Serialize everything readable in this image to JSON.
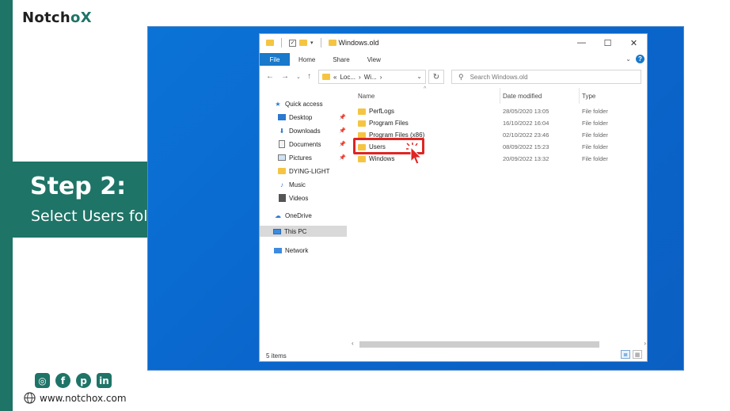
{
  "brand": {
    "name_main": "Notch",
    "name_o": "o",
    "name_x": "X"
  },
  "step": {
    "title": "Step 2:",
    "subtitle": "Select Users folder"
  },
  "social": {
    "instagram": "◎",
    "facebook": "f",
    "pinterest": "p",
    "linkedin": "in"
  },
  "website": "www.notchox.com",
  "explorer": {
    "window_title": "Windows.old",
    "tabs": [
      "File",
      "Home",
      "Share",
      "View"
    ],
    "address": {
      "prefix": "«",
      "part1": "Loc...",
      "part2": "Wi...",
      "sep": "›"
    },
    "search_placeholder": "Search Windows.old",
    "columns": {
      "name": "Name",
      "date": "Date modified",
      "type": "Type"
    },
    "nav": {
      "quick_access": "Quick access",
      "desktop": "Desktop",
      "downloads": "Downloads",
      "documents": "Documents",
      "pictures": "Pictures",
      "dying_light": "DYING-LIGHT",
      "music": "Music",
      "videos": "Videos",
      "onedrive": "OneDrive",
      "this_pc": "This PC",
      "network": "Network"
    },
    "files": [
      {
        "name": "PerfLogs",
        "date": "28/05/2020 13:05",
        "type": "File folder"
      },
      {
        "name": "Program Files",
        "date": "16/10/2022 16:04",
        "type": "File folder"
      },
      {
        "name": "Program Files (x86)",
        "date": "02/10/2022 23:46",
        "type": "File folder"
      },
      {
        "name": "Users",
        "date": "08/09/2022 15:23",
        "type": "File folder"
      },
      {
        "name": "Windows",
        "date": "20/09/2022 13:32",
        "type": "File folder"
      }
    ],
    "status": "5 items",
    "selected_item": "Users"
  },
  "colors": {
    "brand_green": "#1e7467",
    "desktop_blue": "#0a66cc",
    "ribbon_blue": "#1979ca",
    "highlight_red": "#e02424"
  }
}
